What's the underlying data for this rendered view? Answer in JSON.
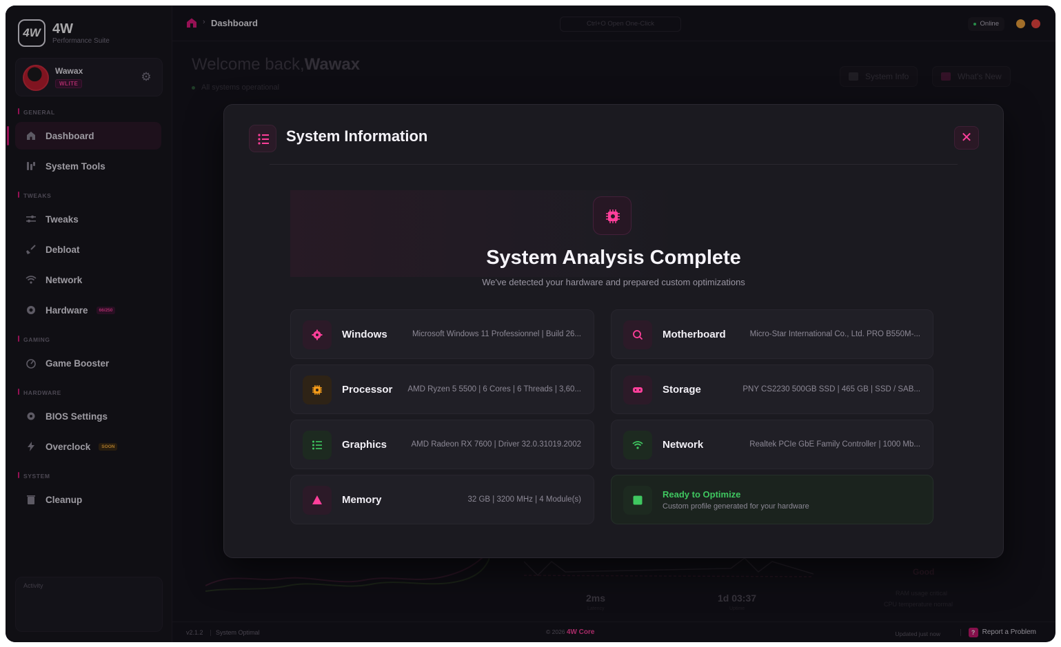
{
  "brand": {
    "name": "4W",
    "logo_text": "4W",
    "subtitle": "Performance Suite"
  },
  "profile": {
    "name": "Wawax",
    "badge": "WLITE"
  },
  "sidebar": {
    "sections": {
      "general": "GENERAL",
      "tweaks": "TWEAKS",
      "gaming": "GAMING",
      "hardware": "HARDWARE",
      "system": "SYSTEM"
    },
    "items": [
      {
        "label": "Dashboard",
        "icon": "dashboard-icon"
      },
      {
        "label": "System Tools",
        "icon": "tools-icon"
      },
      {
        "label": "Tweaks",
        "icon": "sliders-icon"
      },
      {
        "label": "Debloat",
        "icon": "broom-icon"
      },
      {
        "label": "Network",
        "icon": "wifi-icon"
      },
      {
        "label": "Hardware",
        "icon": "chip-icon",
        "tag": "66/250"
      },
      {
        "label": "Game Booster",
        "icon": "gauge-icon"
      },
      {
        "label": "BIOS Settings",
        "icon": "gear-icon"
      },
      {
        "label": "Overclock",
        "icon": "lightning-icon",
        "tag": "SOON"
      },
      {
        "label": "Cleanup",
        "icon": "trash-icon"
      }
    ],
    "activity_label": "Activity"
  },
  "topbar": {
    "breadcrumb": "Dashboard",
    "breadcrumb_sep": "›",
    "shortcut_hint": "Ctrl+O Open One-Click",
    "status": "Online"
  },
  "background": {
    "welcome_prefix": "Welcome back,",
    "welcome_name": "Wawax",
    "status_line": "All systems operational",
    "system_info_btn": "System Info",
    "whats_new_btn": "What's New",
    "latency_value": "2ms",
    "latency_label": "Latency",
    "uptime_value": "1d 03:37",
    "uptime_label": "Uptime",
    "health": "Good",
    "note_ram": "RAM usage critical",
    "note_cpu": "CPU temperature normal"
  },
  "modal": {
    "title": "System Information",
    "close_label": "✕",
    "analysis_title": "System Analysis Complete",
    "analysis_sub": "We've detected your hardware and prepared custom optimizations",
    "cards": {
      "windows": {
        "label": "Windows",
        "value": "Microsoft Windows 11 Professionnel | Build 26..."
      },
      "motherboard": {
        "label": "Motherboard",
        "value": "Micro-Star International Co., Ltd. PRO B550M-..."
      },
      "processor": {
        "label": "Processor",
        "value": "AMD Ryzen 5 5500 | 6 Cores | 6 Threads | 3,60..."
      },
      "storage": {
        "label": "Storage",
        "value": "PNY CS2230 500GB SSD | 465 GB | SSD / SAB..."
      },
      "graphics": {
        "label": "Graphics",
        "value": "AMD Radeon RX 7600 | Driver 32.0.31019.2002"
      },
      "network": {
        "label": "Network",
        "value": "Realtek PCIe GbE Family Controller | 1000 Mb..."
      },
      "memory": {
        "label": "Memory",
        "value": "32 GB | 3200 MHz | 4 Module(s)"
      },
      "ready": {
        "title": "Ready to Optimize",
        "sub": "Custom profile generated for your hardware"
      }
    }
  },
  "footer": {
    "version": "v2.1.2",
    "system_status": "System Optimal",
    "copyright_prefix": "© 2026 ",
    "copyright_brand": "4W Core",
    "updated": "Updated just now",
    "report": "Report a Problem"
  },
  "colors": {
    "accent": "#e0187b",
    "accent_text": "#ff3f9a",
    "ready": "#3fc760",
    "processor": "#f29a1a"
  }
}
